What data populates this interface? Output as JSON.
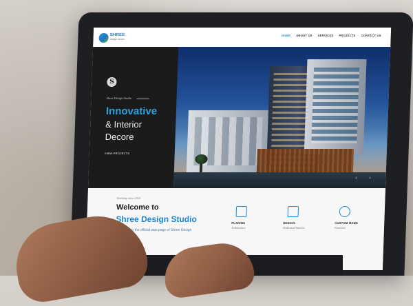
{
  "nav": {
    "logo_text": "SHREE",
    "logo_subtext": "design studio",
    "links": [
      "HOME",
      "ABOUT US",
      "SERVICES",
      "PROJECTS",
      "CONTACT US"
    ],
    "active_link": "HOME",
    "accent_color": "#1E88D8"
  },
  "hero": {
    "studio_name": "Shree Design Studio",
    "headline_1": "Innovative",
    "headline_2": "& Interior",
    "headline_3": "Decore",
    "cta": "VIEW PROJECTS",
    "slider_prev_icon": "chevron-left-icon",
    "slider_next_icon": "chevron-right-icon"
  },
  "welcome": {
    "working_since": "Working since 2010",
    "welcome_to": "Welcome to",
    "brand": "Shree Design Studio",
    "description": "Welcome to the official web page of Shree Design",
    "features": [
      {
        "title": "PLANING",
        "subtitle": "Architecture",
        "icon": "blueprint-icon"
      },
      {
        "title": "DESIGN",
        "subtitle": "Dedicated Interior",
        "icon": "ruler-pencil-icon"
      },
      {
        "title": "CUSTOM MADE",
        "subtitle": "Furniture",
        "icon": "sofa-icon"
      }
    ]
  }
}
